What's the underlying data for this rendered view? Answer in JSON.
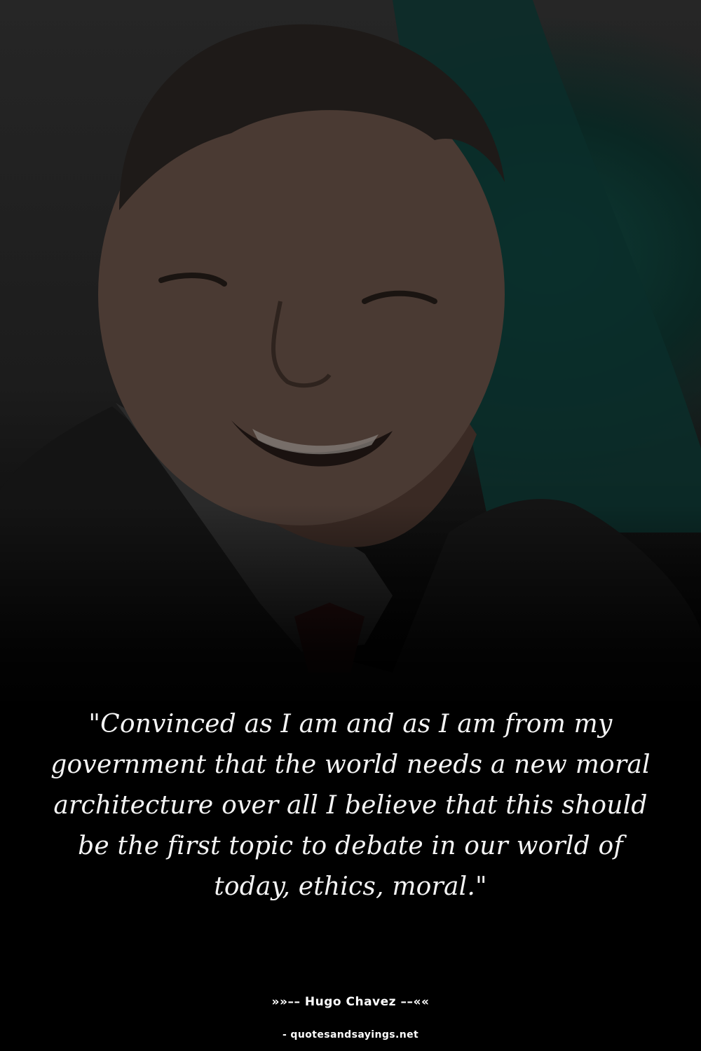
{
  "photo": {
    "subject": "smiling man in dark suit with green flag behind"
  },
  "quote": {
    "text": "\"Convinced as I am and as I am from my government that the world needs a new moral architecture over all I believe that this should be the first topic to debate in our world of today, ethics, moral.\""
  },
  "author": {
    "line": "»»–– Hugo Chavez ––««"
  },
  "source": {
    "text": "- quotesandsayings.net"
  },
  "colors": {
    "background": "#000000",
    "text": "#ffffff",
    "flag_green": "#0d3b35"
  }
}
